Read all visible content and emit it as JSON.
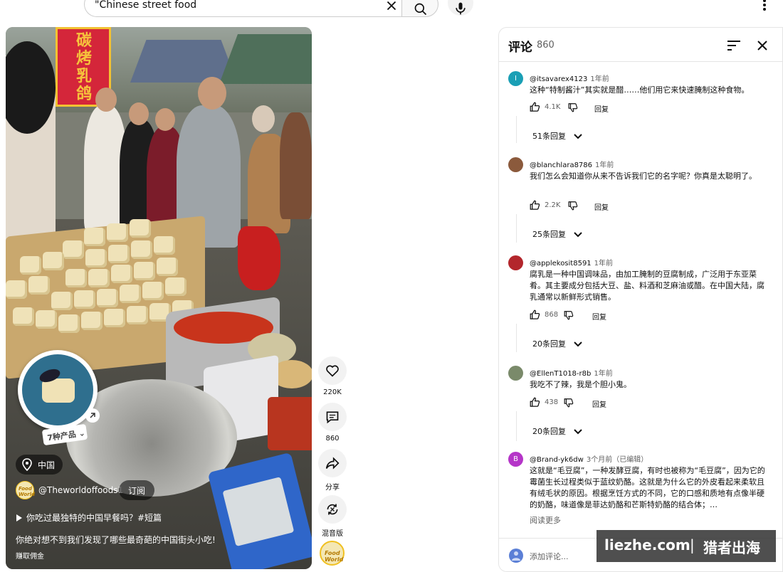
{
  "search": {
    "query": "\"Chinese street food",
    "icons": {
      "clear": "close-icon",
      "search": "search-icon",
      "mic": "mic-icon",
      "more": "more-vert-icon"
    }
  },
  "video": {
    "banner_text": "碳烤乳鸽",
    "products_tag": "7种产品",
    "location": "中国",
    "channel_name": "@Theworldoffoods1",
    "channel_logo_text": "Food World",
    "subscribe_label": "订阅",
    "playlist_title": "你吃过最独特的中国早餐吗？#短篇",
    "caption": "你绝对想不到我们发现了哪些最奇葩的中国街头小吃!",
    "earn_label": "赚取佣金"
  },
  "actions": {
    "like_count": "220K",
    "comment_count": "860",
    "share_label": "分享",
    "remix_label": "混音版"
  },
  "comments_panel": {
    "title": "评论",
    "count": "860",
    "add_placeholder": "添加评论...",
    "reply_label": "回复",
    "read_more": "阅读更多",
    "items": [
      {
        "author": "@itsavarex4123",
        "time": "1年前",
        "avatar_letter": "I",
        "avatar_color": "#1a9fb5",
        "text": "这种“特制酱汁”其实就是醋……他们用它来快速腌制这种食物。",
        "likes": "4.1K",
        "replies": "51条回复"
      },
      {
        "author": "@blanchlara8786",
        "time": "1年前",
        "avatar_letter": "",
        "avatar_color": "#8b5a3c",
        "text": "我们怎么会知道你从来不告诉我们它的名字呢？你真是太聪明了。",
        "likes": "2.2K",
        "replies": "25条回复"
      },
      {
        "author": "@applekosit8591",
        "time": "1年前",
        "avatar_letter": "",
        "avatar_color": "#b3262c",
        "text": "腐乳是一种中国调味品，由加工腌制的豆腐制成，广泛用于东亚菜肴。其主要成分包括大豆、盐、料酒和芝麻油或醋。在中国大陆，腐乳通常以新鲜形式销售。",
        "likes": "868",
        "replies": "20条回复"
      },
      {
        "author": "@EllenT1018-r8b",
        "time": "1年前",
        "avatar_letter": "",
        "avatar_color": "#7a8a6a",
        "text": "我吃不了辣，我是个胆小鬼。",
        "likes": "438",
        "replies": "20条回复"
      },
      {
        "author": "@Brand-yk6dw",
        "time": "3个月前（已编辑）",
        "avatar_letter": "B",
        "avatar_color": "#b535c8",
        "text": "这就是“毛豆腐”，一种发酵豆腐，有时也被称为“毛豆腐”，因为它的霉菌生长过程类似于蓝纹奶酪。这就是为什么它的外皮看起来柔软且有绒毛状的原因。根据烹饪方式的不同，它的口感和质地有点像半硬的奶酪，味道像是菲达奶酪和芒斯特奶酪的结合体；…",
        "likes": "",
        "replies": ""
      }
    ]
  },
  "watermark": {
    "site": "liezhe.com",
    "separator": "|",
    "brand": "猎者出海"
  }
}
